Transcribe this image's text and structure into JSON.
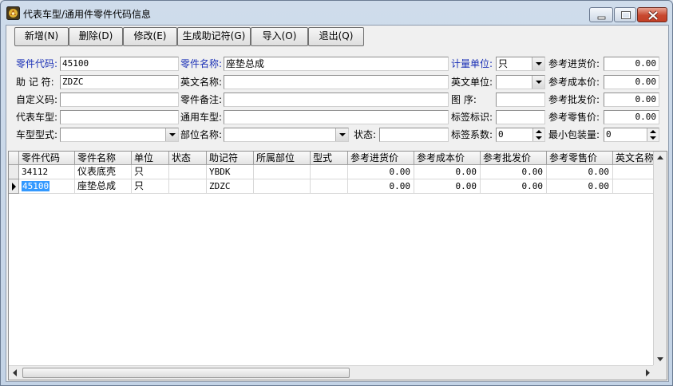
{
  "window": {
    "title": "代表车型/通用件零件代码信息",
    "icon": "app-icon"
  },
  "toolbar": {
    "buttons": [
      {
        "label": "新增(N)"
      },
      {
        "label": "删除(D)"
      },
      {
        "label": "修改(E)"
      },
      {
        "label": "生成助记符(G)"
      },
      {
        "label": "导入(O)"
      },
      {
        "label": "退出(Q)"
      }
    ]
  },
  "form": {
    "part_code_label": "零件代码:",
    "part_code_value": "45100",
    "part_name_label": "零件名称:",
    "part_name_value": "座垫总成",
    "unit_label": "计量单位:",
    "unit_value": "只",
    "ref_purchase_label": "参考进货价:",
    "ref_purchase_value": "0.00",
    "mnemonic_label": "助 记 符:",
    "mnemonic_value": "ZDZC",
    "english_name_label": "英文名称:",
    "english_name_value": "",
    "english_unit_label": "英文单位:",
    "english_unit_value": "",
    "ref_cost_label": "参考成本价:",
    "ref_cost_value": "0.00",
    "custom_code_label": "自定义码:",
    "custom_code_value": "",
    "part_note_label": "零件备注:",
    "part_note_value": "",
    "figure_label": "图    序:",
    "figure_value": "",
    "ref_wholesale_label": "参考批发价:",
    "ref_wholesale_value": "0.00",
    "rep_model_label": "代表车型:",
    "rep_model_value": "",
    "common_model_label": "通用车型:",
    "common_model_value": "",
    "tag_mark_label": "标签标识:",
    "tag_mark_value": "",
    "ref_retail_label": "参考零售价:",
    "ref_retail_value": "0.00",
    "model_type_label": "车型型式:",
    "model_type_value": "",
    "part_location_label": "部位名称:",
    "part_location_value": "",
    "status_label": "状态:",
    "status_value": "",
    "tag_factor_label": "标签系数:",
    "tag_factor_value": "0",
    "min_pack_label": "最小包装量:",
    "min_pack_value": "0"
  },
  "table": {
    "columns": [
      "零件代码",
      "零件名称",
      "单位",
      "状态",
      "助记符",
      "所属部位",
      "型式",
      "参考进货价",
      "参考成本价",
      "参考批发价",
      "参考零售价",
      "英文名称"
    ],
    "rows": [
      {
        "code": "34112",
        "name": "仪表底壳",
        "unit": "只",
        "status": "",
        "mnemonic": "YBDK",
        "location": "",
        "type": "",
        "purchase": "0.00",
        "cost": "0.00",
        "wholesale": "0.00",
        "retail": "0.00",
        "english": ""
      },
      {
        "code": "45100",
        "name": "座垫总成",
        "unit": "只",
        "status": "",
        "mnemonic": "ZDZC",
        "location": "",
        "type": "",
        "purchase": "0.00",
        "cost": "0.00",
        "wholesale": "0.00",
        "retail": "0.00",
        "english": ""
      }
    ],
    "selected_row": 1
  }
}
